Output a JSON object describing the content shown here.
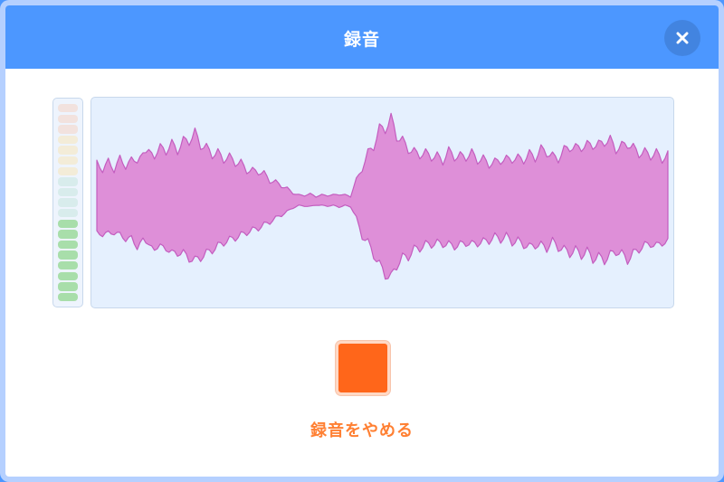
{
  "dialog": {
    "title": "録音",
    "close_icon": "close-icon"
  },
  "level_meter": {
    "segments_total": 19,
    "active_segments": 8,
    "colors": {
      "active": "#a8deaa",
      "inactive_top": "#f2e2de",
      "inactive_mid": "#f3ecd8",
      "inactive_low": "#d8ecec"
    }
  },
  "waveform": {
    "fill_color": "#de8fd8",
    "stroke_color": "#c35dbf",
    "background": "#e5f0fe",
    "amplitudes": [
      0.33,
      0.31,
      0.34,
      0.3,
      0.36,
      0.35,
      0.37,
      0.42,
      0.4,
      0.45,
      0.44,
      0.47,
      0.46,
      0.52,
      0.49,
      0.53,
      0.56,
      0.6,
      0.54,
      0.5,
      0.46,
      0.44,
      0.4,
      0.39,
      0.36,
      0.34,
      0.3,
      0.28,
      0.27,
      0.24,
      0.2,
      0.17,
      0.14,
      0.11,
      0.07,
      0.05,
      0.05,
      0.06,
      0.04,
      0.05,
      0.05,
      0.05,
      0.06,
      0.05,
      0.05,
      0.18,
      0.33,
      0.42,
      0.52,
      0.64,
      0.7,
      0.75,
      0.62,
      0.55,
      0.52,
      0.46,
      0.45,
      0.43,
      0.42,
      0.41,
      0.4,
      0.44,
      0.43,
      0.42,
      0.41,
      0.43,
      0.4,
      0.39,
      0.37,
      0.35,
      0.38,
      0.36,
      0.4,
      0.39,
      0.41,
      0.44,
      0.42,
      0.45,
      0.46,
      0.4,
      0.43,
      0.47,
      0.51,
      0.48,
      0.52,
      0.5,
      0.55,
      0.53,
      0.57,
      0.54,
      0.49,
      0.51,
      0.56,
      0.5,
      0.46,
      0.44,
      0.42,
      0.44,
      0.4,
      0.41
    ],
    "noise": [
      0.06,
      -0.05,
      0.07,
      -0.04,
      0.08,
      -0.06,
      0.05,
      -0.07,
      0.06,
      0.04,
      -0.05,
      0.08,
      -0.03,
      0.07,
      -0.06,
      0.09,
      -0.04,
      0.1,
      -0.06,
      0.05,
      -0.07,
      0.06,
      -0.05,
      0.07,
      -0.04,
      0.06,
      -0.05,
      0.04,
      -0.03,
      0.05,
      -0.04,
      0.03,
      -0.02,
      0.02,
      -0.01,
      0.01,
      -0.01,
      0.01,
      -0.01,
      0.01,
      -0.01,
      0.01,
      -0.01,
      0.01,
      -0.02,
      0.04,
      -0.06,
      0.08,
      -0.05,
      0.1,
      -0.07,
      0.09,
      -0.06,
      0.07,
      -0.08,
      0.05,
      -0.06,
      0.07,
      -0.05,
      0.06,
      -0.07,
      0.08,
      -0.06,
      0.05,
      -0.04,
      0.07,
      -0.06,
      0.05,
      -0.07,
      0.06,
      -0.04,
      0.08,
      -0.05,
      0.06,
      -0.07,
      0.05,
      -0.06,
      0.09,
      -0.05,
      0.07,
      -0.08,
      0.06,
      -0.05,
      0.07,
      -0.06,
      0.08,
      -0.07,
      0.05,
      -0.06,
      0.09,
      -0.05,
      0.06,
      -0.07,
      0.05,
      -0.06,
      0.07,
      -0.04,
      0.06,
      -0.05,
      0.07
    ]
  },
  "record": {
    "stop_button_color": "#ff661a",
    "stop_label": "録音をやめる",
    "label_color": "#ff8033",
    "stop_icon": "stop-icon"
  }
}
